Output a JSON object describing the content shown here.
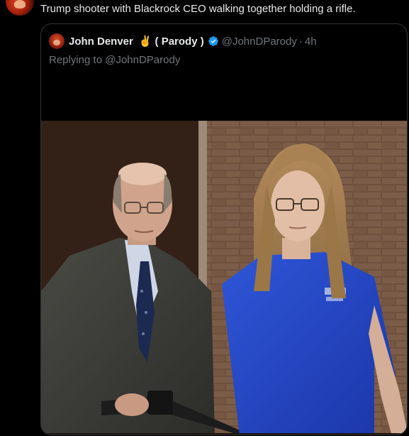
{
  "tweet": {
    "text": "Trump shooter with Blackrock CEO walking together holding a rifle."
  },
  "quote": {
    "author_name": "John Denver",
    "emoji": "✌️",
    "parody_label": "( Parody )",
    "handle": "@JohnDParody",
    "separator": "·",
    "time": "4h",
    "replying_to": "Replying to @JohnDParody"
  },
  "colors": {
    "background": "#000000",
    "border": "#2f3336",
    "text_primary": "#e7e9ea",
    "text_secondary": "#71767b",
    "verified": "#1d9bf0"
  }
}
